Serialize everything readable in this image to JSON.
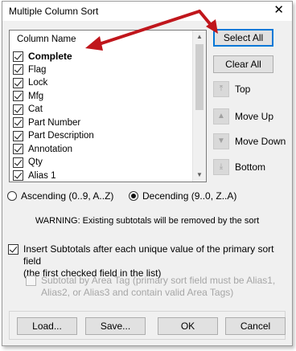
{
  "window": {
    "title": "Multiple Column Sort",
    "close_label": "✕"
  },
  "list": {
    "header": "Column Name",
    "items": [
      {
        "label": "Complete",
        "checked": true,
        "bold": true
      },
      {
        "label": "Flag",
        "checked": true,
        "bold": false
      },
      {
        "label": "Lock",
        "checked": true,
        "bold": false
      },
      {
        "label": "Mfg",
        "checked": true,
        "bold": false
      },
      {
        "label": "Cat",
        "checked": true,
        "bold": false
      },
      {
        "label": "Part Number",
        "checked": true,
        "bold": false
      },
      {
        "label": "Part Description",
        "checked": true,
        "bold": false
      },
      {
        "label": "Annotation",
        "checked": true,
        "bold": false
      },
      {
        "label": "Qty",
        "checked": true,
        "bold": false
      },
      {
        "label": "Alias 1",
        "checked": true,
        "bold": false
      }
    ]
  },
  "side_buttons": {
    "select_all": "Select All",
    "clear_all": "Clear All",
    "top": "Top",
    "move_up": "Move Up",
    "move_down": "Move Down",
    "bottom": "Bottom"
  },
  "sort_order": {
    "ascending": "Ascending (0..9, A..Z)",
    "descending": "Decending (9..0, Z..A)",
    "selected": "descending"
  },
  "warning": "WARNING: Existing subtotals will be removed by the sort",
  "subtotals": {
    "line1": "Insert Subtotals after each unique value of the primary sort field",
    "line2": "(the first checked field in the list)",
    "checked": true
  },
  "area_tag": {
    "line1": "Subtotal by Area Tag (primary sort field must be Alias1,",
    "line2": "Alias2, or Alias3 and contain valid Area Tags)",
    "checked": false,
    "enabled": false
  },
  "footer": {
    "load": "Load...",
    "save": "Save...",
    "ok": "OK",
    "cancel": "Cancel"
  },
  "colors": {
    "annotation_arrow": "#c0161c",
    "default_button_border": "#0078d7"
  }
}
